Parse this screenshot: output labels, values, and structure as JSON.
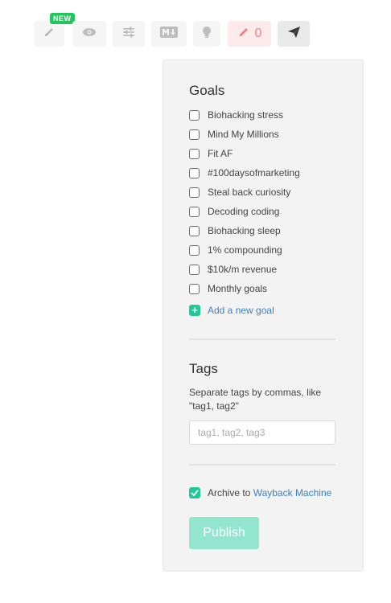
{
  "toolbar": {
    "new_badge": "NEW",
    "pencil_count": "0"
  },
  "goals": {
    "title": "Goals",
    "items": [
      {
        "label": "Biohacking stress",
        "checked": false
      },
      {
        "label": "Mind My Millions",
        "checked": false
      },
      {
        "label": "Fit AF",
        "checked": false
      },
      {
        "label": "#100daysofmarketing",
        "checked": false
      },
      {
        "label": "Steal back curiosity",
        "checked": false
      },
      {
        "label": "Decoding coding",
        "checked": false
      },
      {
        "label": "Biohacking sleep",
        "checked": false
      },
      {
        "label": "1% compounding",
        "checked": false
      },
      {
        "label": "$10k/m revenue",
        "checked": false
      },
      {
        "label": "Monthly goals",
        "checked": false
      }
    ],
    "add_label": "Add a new goal"
  },
  "tags": {
    "title": "Tags",
    "help": "Separate tags by commas, like \"tag1, tag2\"",
    "placeholder": "tag1, tag2, tag3",
    "value": ""
  },
  "archive": {
    "checked": true,
    "prefix": "Archive to ",
    "link": "Wayback Machine"
  },
  "publish_label": "Publish",
  "colors": {
    "accent": "#20c997",
    "link": "#3b82c4",
    "badge": "#22c55e",
    "publish_bg": "#93e6ce",
    "pencil_active": "#f08080"
  }
}
